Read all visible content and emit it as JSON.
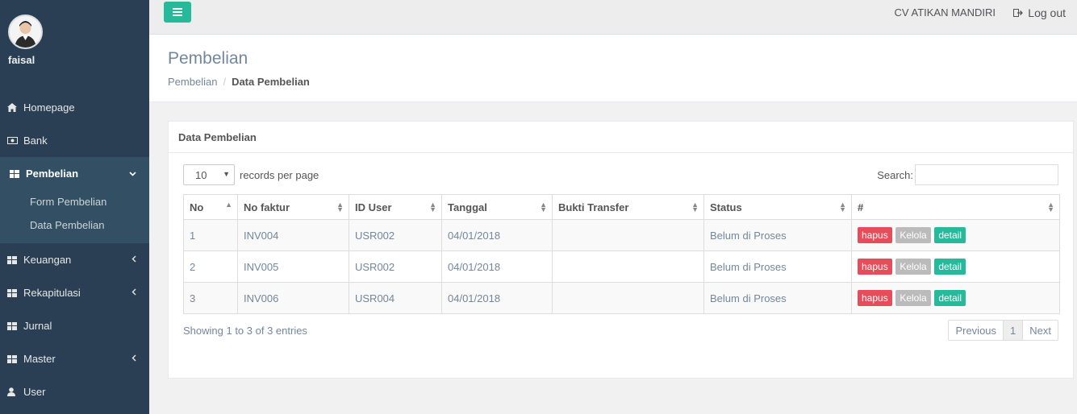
{
  "sidebar": {
    "user_name": "faisal",
    "menu": [
      {
        "label": "Homepage",
        "icon": "home-icon"
      },
      {
        "label": "Bank",
        "icon": "money-icon"
      },
      {
        "label": "Pembelian",
        "icon": "table-icon"
      },
      {
        "label": "Keuangan",
        "icon": "table-icon"
      },
      {
        "label": "Rekapitulasi",
        "icon": "table-icon"
      },
      {
        "label": "Jurnal",
        "icon": "table-icon"
      },
      {
        "label": "Master",
        "icon": "table-icon"
      },
      {
        "label": "User",
        "icon": "user-icon"
      }
    ],
    "submenu": [
      "Form Pembelian",
      "Data Pembelian"
    ]
  },
  "topnav": {
    "company": "CV ATIKAN MANDIRI",
    "logout": "Log out"
  },
  "header": {
    "title": "Pembelian",
    "breadcrumb": [
      "Pembelian",
      "Data Pembelian"
    ]
  },
  "panel": {
    "title": "Data Pembelian",
    "page_length": "10",
    "records_label": "records per page",
    "search_label": "Search:",
    "columns": [
      "No",
      "No faktur",
      "ID User",
      "Tanggal",
      "Bukti Transfer",
      "Status",
      "#"
    ],
    "rows": [
      {
        "no": "1",
        "faktur": "INV004",
        "user": "USR002",
        "tanggal": "04/01/2018",
        "bukti": "",
        "status": "Belum di Proses"
      },
      {
        "no": "2",
        "faktur": "INV005",
        "user": "USR002",
        "tanggal": "04/01/2018",
        "bukti": "",
        "status": "Belum di Proses"
      },
      {
        "no": "3",
        "faktur": "INV006",
        "user": "USR004",
        "tanggal": "04/01/2018",
        "bukti": "",
        "status": "Belum di Proses"
      }
    ],
    "actions": {
      "delete": "hapus",
      "manage": "Kelola",
      "detail": "detail"
    },
    "info": "Showing 1 to 3 of 3 entries",
    "pager": {
      "previous": "Previous",
      "page": "1",
      "next": "Next"
    }
  },
  "colors": {
    "sidebar": "#2A3F54",
    "accent": "#26B99A",
    "danger": "#E74C5B",
    "muted": "#BBBBBB"
  }
}
